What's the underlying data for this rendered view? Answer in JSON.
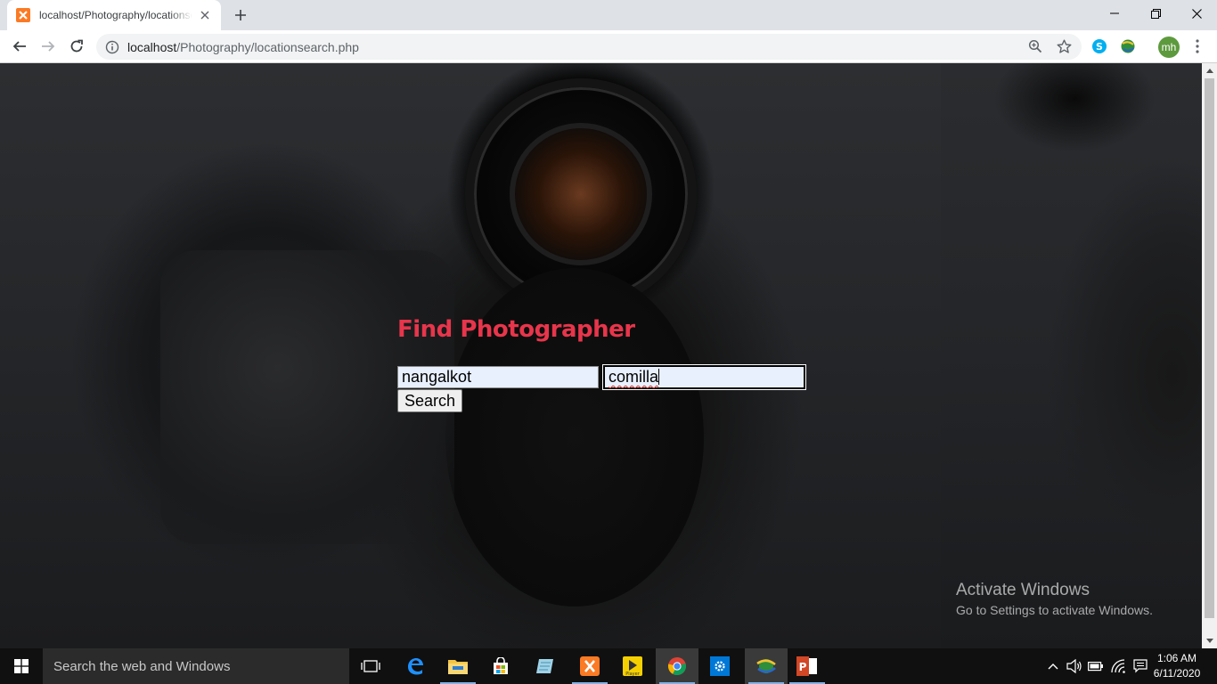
{
  "browser": {
    "tab_title": "localhost/Photography/locationsearch.php",
    "url_host": "localhost",
    "url_path": "/Photography/locationsearch.php",
    "profile_initials": "mh"
  },
  "page": {
    "heading": "Find Photographer",
    "location_input_value": "nangalkot",
    "district_input_value": "comilla",
    "search_button_label": "Search",
    "accent_color": "#e8354b"
  },
  "watermark": {
    "title": "Activate Windows",
    "subtitle": "Go to Settings to activate Windows."
  },
  "taskbar": {
    "search_placeholder": "Search the web and Windows",
    "time": "1:06 AM",
    "date": "6/11/2020"
  }
}
